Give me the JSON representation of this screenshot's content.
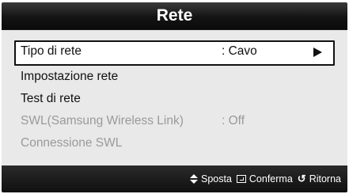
{
  "header": {
    "title": "Rete"
  },
  "menu": {
    "items": [
      {
        "label": "Tipo di rete",
        "value": ": Cavo",
        "selected": true,
        "enabled": true
      },
      {
        "label": "Impostazione rete",
        "value": "",
        "selected": false,
        "enabled": true
      },
      {
        "label": "Test di rete",
        "value": "",
        "selected": false,
        "enabled": true
      },
      {
        "label": "SWL(Samsung Wireless Link)",
        "value": ": Off",
        "selected": false,
        "enabled": false
      },
      {
        "label": "Connessione SWL",
        "value": "",
        "selected": false,
        "enabled": false
      }
    ],
    "selected_arrow_icon": "right-triangle-icon"
  },
  "footer": {
    "hints": [
      {
        "icon": "up-down-arrows-icon",
        "label": "Sposta"
      },
      {
        "icon": "enter-icon",
        "label": "Conferma"
      },
      {
        "icon": "return-icon",
        "label": "Ritorna"
      }
    ]
  }
}
